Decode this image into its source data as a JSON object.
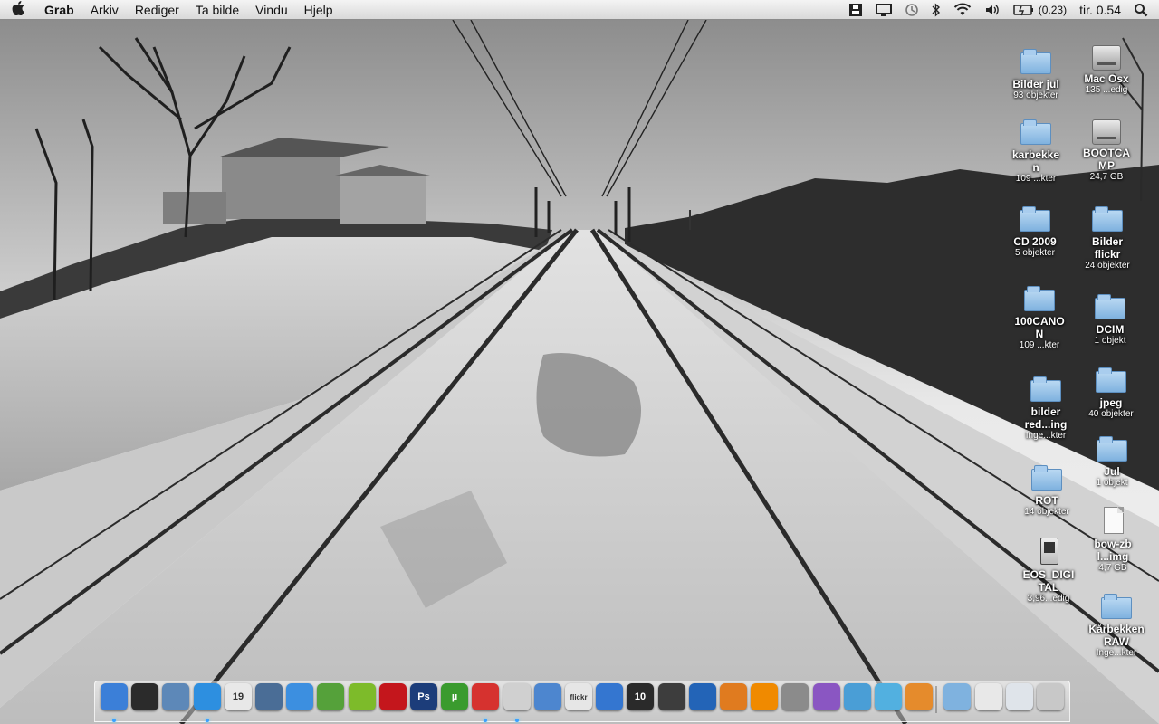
{
  "menubar": {
    "apple_icon": "apple-logo-icon",
    "items": [
      "Grab",
      "Arkiv",
      "Rediger",
      "Ta bilde",
      "Vindu",
      "Hjelp"
    ],
    "battery_text": "(0.23)",
    "clock": "tir. 0.54",
    "status_icons": [
      "app-status-icon",
      "display-icon",
      "time-machine-icon",
      "bluetooth-icon",
      "wifi-icon",
      "volume-icon",
      "battery-icon",
      "spotlight-icon"
    ]
  },
  "desktop": {
    "icons": [
      {
        "type": "folder",
        "name": "Bilder jul",
        "sub": "93 objekter"
      },
      {
        "type": "drive",
        "name": "Mac Osx",
        "sub": "135 ...edig"
      },
      {
        "type": "folder",
        "name": "karbekken",
        "sub": "109 ...kter"
      },
      {
        "type": "drive",
        "name": "BOOTCAMP",
        "sub": "24,7 GB"
      },
      {
        "type": "folder",
        "name": "CD 2009",
        "sub": "5 objekter"
      },
      {
        "type": "folder",
        "name": "Bilder flickr",
        "sub": "24 objekter"
      },
      {
        "type": "folder",
        "name": "100CANON",
        "sub": "109 ...kter"
      },
      {
        "type": "folder",
        "name": "DCIM",
        "sub": "1 objekt"
      },
      {
        "type": "folder",
        "name": "bilder red...ing",
        "sub": "Inge...kter"
      },
      {
        "type": "folder",
        "name": "jpeg",
        "sub": "40 objekter"
      },
      {
        "type": "folder",
        "name": "Jul",
        "sub": "1 objekt"
      },
      {
        "type": "folder",
        "name": "ROT",
        "sub": "14 objekter"
      },
      {
        "type": "document",
        "name": "bow-zbl...img",
        "sub": "4,7 GB"
      },
      {
        "type": "card",
        "name": "EOS_DIGITAL",
        "sub": "3,96...edig"
      },
      {
        "type": "folder",
        "name": "Kårbekken RAW",
        "sub": "Inge...kter"
      }
    ]
  },
  "dock": {
    "items": [
      {
        "icon": "finder-icon",
        "label": "",
        "color": "#3b7fd8",
        "running": true
      },
      {
        "icon": "dashboard-icon",
        "label": "",
        "color": "#2b2b2b",
        "running": false
      },
      {
        "icon": "preview-icon",
        "label": "",
        "color": "#5d88b8",
        "running": false
      },
      {
        "icon": "safari-icon",
        "label": "",
        "color": "#2d8fe0",
        "running": true
      },
      {
        "icon": "ical-icon",
        "label": "19",
        "color": "#e8e8e8",
        "running": false
      },
      {
        "icon": "iphoto-icon",
        "label": "",
        "color": "#4a6d96",
        "running": false
      },
      {
        "icon": "itunes-icon",
        "label": "",
        "color": "#3c8fe0",
        "running": false
      },
      {
        "icon": "adium-icon",
        "label": "",
        "color": "#55a13a",
        "running": false
      },
      {
        "icon": "spotify-icon",
        "label": "",
        "color": "#7dbb2a",
        "running": false
      },
      {
        "icon": "photo-booth-icon",
        "label": "",
        "color": "#c4161c",
        "running": false
      },
      {
        "icon": "photoshop-icon",
        "label": "Ps",
        "color": "#1c3d7a",
        "running": false
      },
      {
        "icon": "utorrent-icon",
        "label": "µ",
        "color": "#3a9b2e",
        "running": false
      },
      {
        "icon": "chrome-icon",
        "label": "",
        "color": "#d6322f",
        "running": true
      },
      {
        "icon": "grab-icon",
        "label": "",
        "color": "#d0d0d0",
        "running": true
      },
      {
        "icon": "iweb-icon",
        "label": "",
        "color": "#4d86cf",
        "running": false
      },
      {
        "icon": "flickr-uploadr-icon",
        "label": "flickr",
        "color": "#e6e6e6",
        "running": false
      },
      {
        "icon": "time-machine-clock-icon",
        "label": "",
        "color": "#3476d0",
        "running": false
      },
      {
        "icon": "final-cut-icon",
        "label": "10",
        "color": "#2a2a2a",
        "running": false
      },
      {
        "icon": "imovie-icon",
        "label": "",
        "color": "#3d3d3d",
        "running": false
      },
      {
        "icon": "google-earth-icon",
        "label": "",
        "color": "#2364b7",
        "running": false
      },
      {
        "icon": "matlab-icon",
        "label": "",
        "color": "#e07b1f",
        "running": false
      },
      {
        "icon": "vlc-icon",
        "label": "",
        "color": "#f08a00",
        "running": false
      },
      {
        "icon": "system-preferences-icon",
        "label": "",
        "color": "#8b8b8b",
        "running": false
      },
      {
        "icon": "purple-app-icon",
        "label": "",
        "color": "#8a56c2",
        "running": false
      },
      {
        "icon": "pages-icon",
        "label": "",
        "color": "#4a9ed6",
        "running": false
      },
      {
        "icon": "wii-app-icon",
        "label": "",
        "color": "#52b0e0",
        "running": false
      },
      {
        "icon": "keynote-icon",
        "label": "",
        "color": "#e58b2c",
        "running": false
      },
      {
        "icon": "applications-folder-icon",
        "label": "",
        "color": "#7fb2df",
        "running": false
      },
      {
        "icon": "downloads-stack-icon",
        "label": "",
        "color": "#e8e8e8",
        "running": false
      },
      {
        "icon": "documents-stack-icon",
        "label": "",
        "color": "#dfe4ea",
        "running": false
      },
      {
        "icon": "trash-icon",
        "label": "",
        "color": "#c8c8c8",
        "running": false
      }
    ]
  }
}
